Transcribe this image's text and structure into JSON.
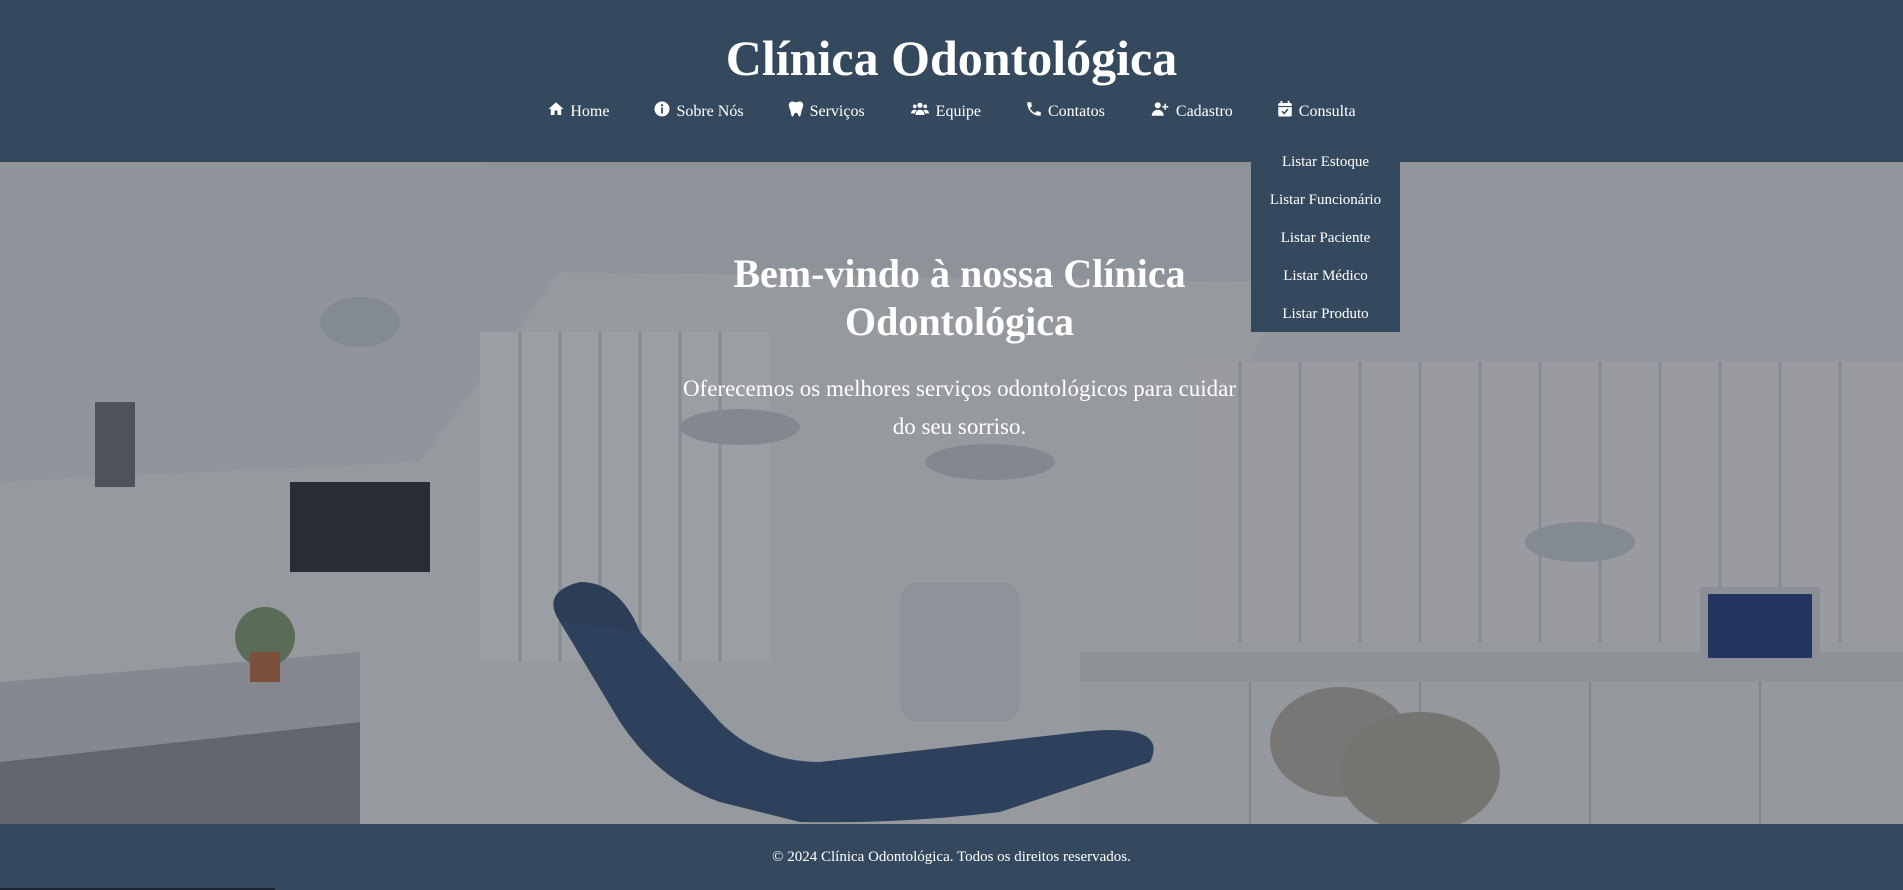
{
  "header": {
    "title": "Clínica Odontológica"
  },
  "nav": {
    "items": [
      {
        "label": "Home",
        "icon": "home-icon"
      },
      {
        "label": "Sobre Nós",
        "icon": "info-icon"
      },
      {
        "label": "Serviços",
        "icon": "tooth-icon"
      },
      {
        "label": "Equipe",
        "icon": "users-icon"
      },
      {
        "label": "Contatos",
        "icon": "phone-icon"
      },
      {
        "label": "Cadastro",
        "icon": "user-plus-icon"
      },
      {
        "label": "Consulta",
        "icon": "calendar-check-icon"
      }
    ]
  },
  "dropdown": {
    "items": [
      "Listar Estoque",
      "Listar Funcionário",
      "Listar Paciente",
      "Listar Médico",
      "Listar Produto"
    ]
  },
  "hero": {
    "title": "Bem-vindo à nossa Clínica Odontológica",
    "text": "Oferecemos os melhores serviços odontológicos para cuidar do seu sorriso."
  },
  "footer": {
    "text": "© 2024 Clínica Odontológica. Todos os direitos reservados."
  },
  "colors": {
    "primary": "#34495e",
    "text": "#ffffff"
  }
}
